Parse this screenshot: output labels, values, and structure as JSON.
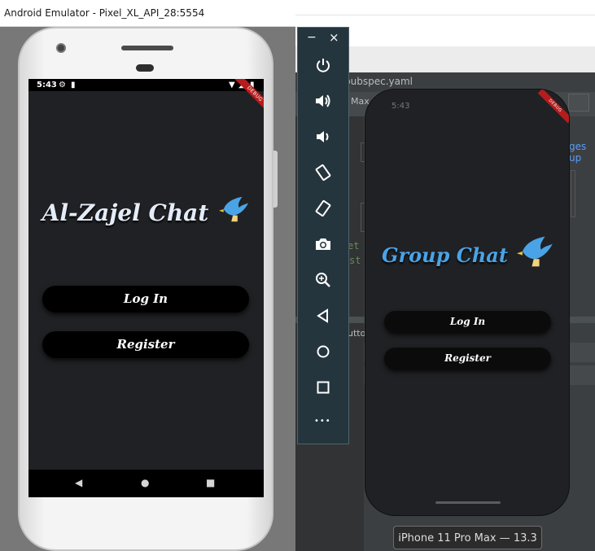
{
  "emulator_window": {
    "title": "Android Emulator - Pixel_XL_API_28:5554"
  },
  "android": {
    "status_time": "5:43",
    "debug_banner": "DEBUG",
    "app_title": "Al-Zajel Chat",
    "login_label": "Log In",
    "register_label": "Register"
  },
  "toolbar": {
    "minimize_glyph": "−",
    "close_glyph": "×",
    "more_glyph": "•••"
  },
  "ide": {
    "file_tab": "pubspec.yaml",
    "device_dropdown": "Max",
    "link_text": "ges up",
    "code_line_1": "et",
    "code_line_2": "st",
    "panel_text": "utto"
  },
  "ios": {
    "status_time": "5:43",
    "debug_banner": "DEBUG",
    "app_title": "Group Chat",
    "login_label": "Log In",
    "register_label": "Register",
    "device_label": "iPhone 11 Pro Max — 13.3"
  },
  "colors": {
    "app_bg": "#202124",
    "brand_blue": "#4aa3e6",
    "toolbar_bg": "#25353e",
    "ide_bg": "#3c3f41"
  },
  "icons": [
    "dove-icon",
    "power-icon",
    "volume-up-icon",
    "volume-down-icon",
    "rotate-left-icon",
    "rotate-right-icon",
    "camera-icon",
    "zoom-icon",
    "back-icon",
    "home-icon",
    "overview-icon",
    "more-icon"
  ]
}
